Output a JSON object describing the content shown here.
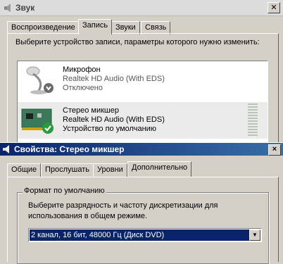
{
  "sound_window": {
    "title": "Звук",
    "close_glyph": "✕",
    "tabs": [
      "Воспроизведение",
      "Запись",
      "Звуки",
      "Связь"
    ],
    "active_tab": "Запись",
    "prompt": "Выберите устройство записи, параметры которого нужно изменить:",
    "devices": [
      {
        "name": "Микрофон",
        "driver": "Realtek HD Audio (With EDS)",
        "status": "Отключено",
        "icon": "microphone-icon",
        "badge": "disabled-down-arrow-icon"
      },
      {
        "name": "Стерео микшер",
        "driver": "Realtek HD Audio (With EDS)",
        "status": "Устройство по умолчанию",
        "icon": "sound-card-icon",
        "badge": "default-checkmark-icon"
      }
    ]
  },
  "props_window": {
    "title": "Свойства: Стерео микшер",
    "close_glyph": "×",
    "tabs": [
      "Общие",
      "Прослушать",
      "Уровни",
      "Дополнительно"
    ],
    "active_tab": "Дополнительно",
    "group_label": "Формат по умолчанию",
    "prompt": "Выберите разрядность и частоту дискретизации для использования в общем режиме.",
    "format_value": "2 канал, 16 бит, 48000 Гц (Диск DVD)",
    "dropdown_glyph": "▼"
  },
  "colors": {
    "title_active_start": "#0a246a",
    "title_active_end": "#3a6ea5",
    "selection": "#0a246a"
  }
}
